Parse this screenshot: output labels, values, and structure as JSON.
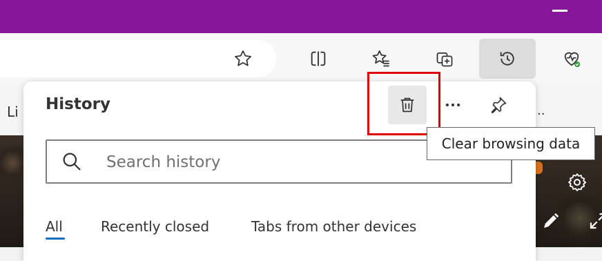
{
  "panel": {
    "title": "History",
    "search_placeholder": "Search history",
    "tabs": [
      {
        "label": "All",
        "selected": true
      },
      {
        "label": "Recently closed",
        "selected": false
      },
      {
        "label": "Tabs from other devices",
        "selected": false
      }
    ]
  },
  "tooltip": {
    "text": "Clear browsing data"
  },
  "favorites_bar": {
    "partial_label": "Li"
  },
  "icons": [
    "minimize-icon",
    "favorite-star-icon",
    "split-screen-icon",
    "favorites-icon",
    "collections-icon",
    "history-icon",
    "browser-essentials-icon",
    "trash-icon",
    "more-icon",
    "pin-icon",
    "search-icon",
    "settings-icon",
    "edit-icon",
    "expand-icon"
  ],
  "colors": {
    "titlebar": "#87169b",
    "highlight": "#e00000",
    "tab_underline": "#0f6cbd",
    "status_green": "#2e9e3e"
  }
}
